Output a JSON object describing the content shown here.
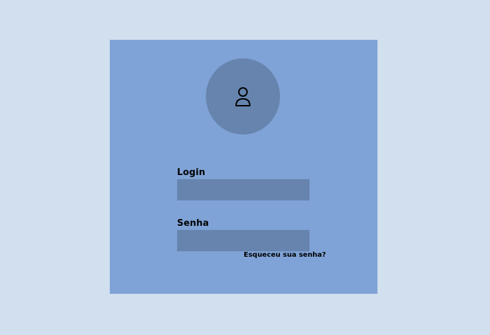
{
  "colors": {
    "background": "#d1dfef",
    "card": "#7fa3d6",
    "avatar_circle": "#6684ae",
    "input_fill": "#6684ae",
    "text": "#000000"
  },
  "avatar": {
    "icon": "user-icon"
  },
  "form": {
    "login_label": "Login",
    "login_value": "",
    "senha_label": "Senha",
    "senha_value": "",
    "forgot_password": "Esqueceu sua senha?"
  }
}
